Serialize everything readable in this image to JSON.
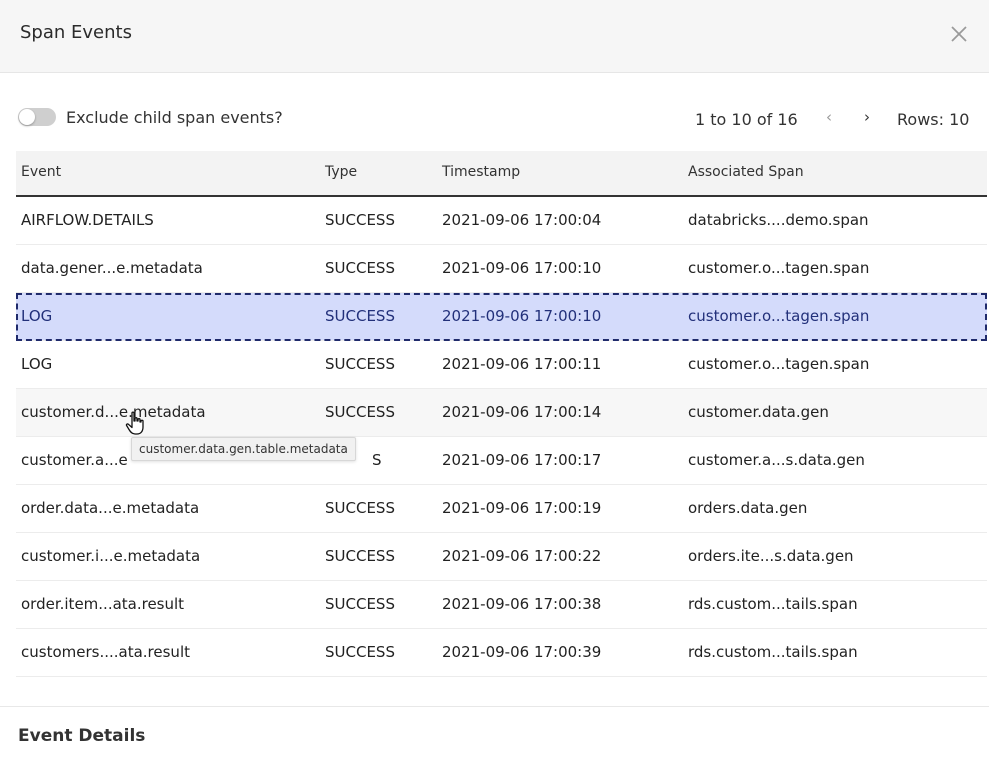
{
  "header": {
    "title": "Span Events",
    "close_icon": "close-icon"
  },
  "toolbar": {
    "toggle_label": "Exclude child span events?",
    "toggle_on": false,
    "pager_range": "1 to 10 of 16",
    "prev_icon": "chevron-left-icon",
    "next_icon": "chevron-right-icon",
    "prev_glyph": "‹",
    "next_glyph": "›",
    "rows_label": "Rows: 10"
  },
  "table": {
    "columns": [
      "Event",
      "Type",
      "Timestamp",
      "Associated Span"
    ],
    "rows": [
      {
        "event": "AIRFLOW.DETAILS",
        "type": "SUCCESS",
        "timestamp": "2021-09-06 17:00:04",
        "span": "databricks....demo.span"
      },
      {
        "event": "data.gener...e.metadata",
        "type": "SUCCESS",
        "timestamp": "2021-09-06 17:00:10",
        "span": "customer.o...tagen.span"
      },
      {
        "event": "LOG",
        "type": "SUCCESS",
        "timestamp": "2021-09-06 17:00:10",
        "span": "customer.o...tagen.span"
      },
      {
        "event": "LOG",
        "type": "SUCCESS",
        "timestamp": "2021-09-06 17:00:11",
        "span": "customer.o...tagen.span"
      },
      {
        "event": "customer.d...e.metadata",
        "type": "SUCCESS",
        "timestamp": "2021-09-06 17:00:14",
        "span": "customer.data.gen"
      },
      {
        "event": "customer.a...e",
        "type": "S",
        "timestamp": "2021-09-06 17:00:17",
        "span": "customer.a...s.data.gen"
      },
      {
        "event": "order.data...e.metadata",
        "type": "SUCCESS",
        "timestamp": "2021-09-06 17:00:19",
        "span": "orders.data.gen"
      },
      {
        "event": "customer.i...e.metadata",
        "type": "SUCCESS",
        "timestamp": "2021-09-06 17:00:22",
        "span": "orders.ite...s.data.gen"
      },
      {
        "event": "order.item...ata.result",
        "type": "SUCCESS",
        "timestamp": "2021-09-06 17:00:38",
        "span": "rds.custom...tails.span"
      },
      {
        "event": "customers....ata.result",
        "type": "SUCCESS",
        "timestamp": "2021-09-06 17:00:39",
        "span": "rds.custom...tails.span"
      }
    ],
    "selected_row": "LOG — 2021-09-06 17:00:10"
  },
  "tooltip": {
    "text": "customer.data.gen.table.metadata"
  },
  "cursor": {
    "icon": "hand-pointer-icon"
  },
  "event_details": {
    "title": "Event Details"
  },
  "colors": {
    "header_bg": "#f6f6f6",
    "selected_row_bg": "#d4dbfb",
    "selected_row_border": "#1f2a6b",
    "toggle_off": "#cfcfcf"
  }
}
